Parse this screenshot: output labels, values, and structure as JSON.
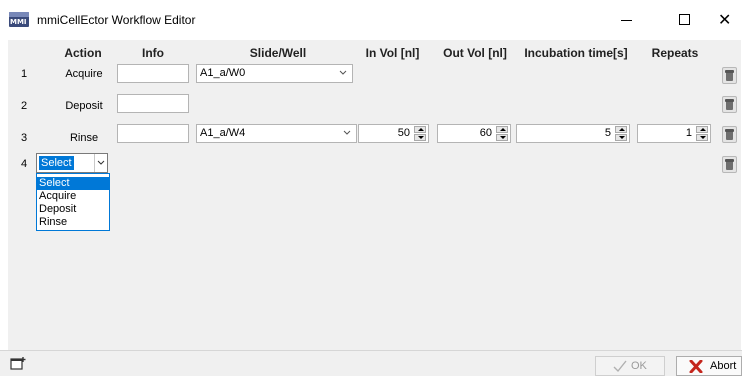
{
  "window": {
    "title": "mmiCellEctor Workflow Editor",
    "logo_text": "MMI"
  },
  "columns": {
    "action": "Action",
    "info": "Info",
    "slide_well": "Slide/Well",
    "in_vol": "In Vol [nl]",
    "out_vol": "Out Vol [nl]",
    "incubation": "Incubation time[s]",
    "repeats": "Repeats"
  },
  "rows": [
    {
      "num": "1",
      "action": "Acquire",
      "info": "",
      "slide_well": "A1_a/W0"
    },
    {
      "num": "2",
      "action": "Deposit",
      "info": ""
    },
    {
      "num": "3",
      "action": "Rinse",
      "info": "",
      "slide_well": "A1_a/W4",
      "in_vol": "50",
      "out_vol": "60",
      "incubation": "5",
      "repeats": "1"
    },
    {
      "num": "4",
      "action_select": "Select"
    }
  ],
  "dropdown": {
    "options": [
      "Select",
      "Acquire",
      "Deposit",
      "Rinse"
    ],
    "highlighted": "Select"
  },
  "footer": {
    "ok_label": "OK",
    "abort_label": "Abort"
  },
  "icons": {
    "trash": "trash-icon",
    "add": "add-step-icon",
    "ok": "checkmark-icon",
    "abort": "red-x-icon"
  }
}
